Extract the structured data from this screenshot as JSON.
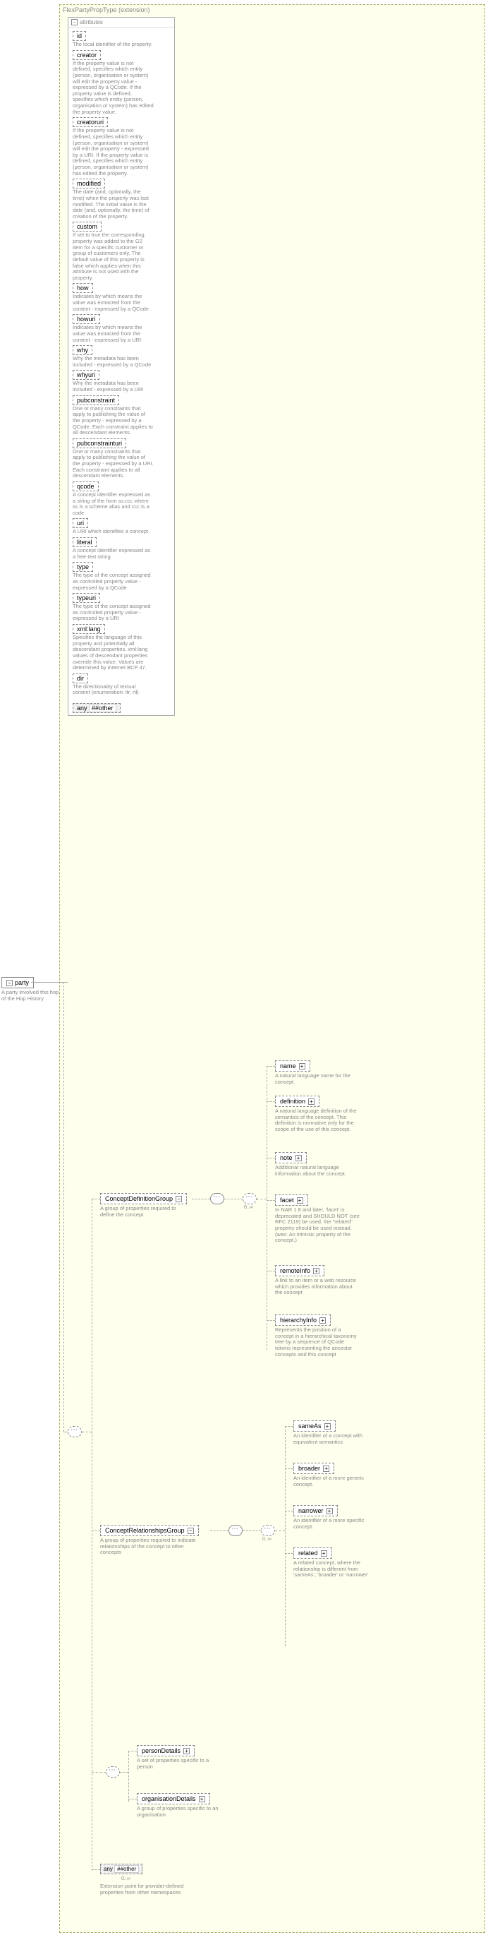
{
  "extension": {
    "title": "FlexPartyPropType (extension)"
  },
  "root": {
    "label": "party",
    "annotation": "A party involved this hop of the Hop History"
  },
  "attributes_title": "attributes",
  "attributes": [
    {
      "label": "id",
      "annotation": "The local identifier of the property."
    },
    {
      "label": "creator",
      "annotation": "If the property value is not defined, specifies which entity (person, organisation or system) will edit the property value - expressed by a QCode. If the property value is defined, specifies which entity (person, organisation or system) has edited the property value."
    },
    {
      "label": "creatoruri",
      "annotation": "If the property value is not defined, specifies which entity (person, organisation or system) will edit the property - expressed by a URI. If the property value is defined, specifies which entity (person, organisation or system) has edited the property."
    },
    {
      "label": "modified",
      "annotation": "The date (and, optionally, the time) when the property was last modified. The initial value is the date (and, optionally, the time) of creation of the property."
    },
    {
      "label": "custom",
      "annotation": "If set to true the corresponding property was added to the G2 Item for a specific customer or group of customers only. The default value of this property is false which applies when this attribute is not used with the property."
    },
    {
      "label": "how",
      "annotation": "Indicates by which means the value was extracted from the content - expressed by a QCode"
    },
    {
      "label": "howuri",
      "annotation": "Indicates by which means the value was extracted from the content - expressed by a URI"
    },
    {
      "label": "why",
      "annotation": "Why the metadata has been included - expressed by a QCode"
    },
    {
      "label": "whyuri",
      "annotation": "Why the metadata has been included - expressed by a URI"
    },
    {
      "label": "pubconstraint",
      "annotation": "One or many constraints that apply to publishing the value of the property - expressed by a QCode. Each constraint applies to all descendant elements."
    },
    {
      "label": "pubconstrainturi",
      "annotation": "One or many constraints that apply to publishing the value of the property - expressed by a URI. Each constraint applies to all descendant elements."
    },
    {
      "label": "qcode",
      "annotation": "A concept identifier expressed as a string of the form ss:ccc where ss is a scheme alias and ccc is a code"
    },
    {
      "label": "uri",
      "annotation": "A URI which identifies a concept."
    },
    {
      "label": "literal",
      "annotation": "A concept identifier expressed as a free text string"
    },
    {
      "label": "type",
      "annotation": "The type of the concept assigned as controlled property value - expressed by a QCode"
    },
    {
      "label": "typeuri",
      "annotation": "The type of the concept assigned as controlled property value - expressed by a URI"
    },
    {
      "label": "xml:lang",
      "annotation": "Specifies the language of this property and potentially all descendant properties. xml:lang values of descendant properties override this value. Values are determined by Internet BCP 47."
    },
    {
      "label": "dir",
      "annotation": "The directionality of textual content (enumeration: ltr, rtl)"
    }
  ],
  "any_attr": {
    "prefix": "any",
    "wildcard": "##other"
  },
  "groups": {
    "defGroup": {
      "label": "ConceptDefinitionGroup",
      "annotation": "A group of properties required to define the concept"
    },
    "relGroup": {
      "label": "ConceptRelationshipsGroup",
      "annotation": "A group of properties required to indicate relationships of the concept to other concepts"
    }
  },
  "defChildren": [
    {
      "label": "name",
      "annotation": "A natural language name for the concept."
    },
    {
      "label": "definition",
      "annotation": "A natural language definition of the semantics of the concept. This definition is normative only for the scope of the use of this concept."
    },
    {
      "label": "note",
      "annotation": "Additional natural language information about the concept."
    },
    {
      "label": "facet",
      "annotation": "In NAR 1.8 and later, 'facet' is deprecated and SHOULD NOT (see RFC 2119) be used, the \"related\" property should be used instead. (was: An intrinsic property of the concept.)"
    },
    {
      "label": "remoteInfo",
      "annotation": "A link to an item or a web resource which provides information about the concept"
    },
    {
      "label": "hierarchyInfo",
      "annotation": "Represents the position of a concept in a hierarchical taxonomy tree by a sequence of QCode tokens representing the ancestor concepts and this concept"
    }
  ],
  "relChildren": [
    {
      "label": "sameAs",
      "annotation": "An identifier of a concept with equivalent semantics"
    },
    {
      "label": "broader",
      "annotation": "An identifier of a more generic concept."
    },
    {
      "label": "narrower",
      "annotation": "An identifier of a more specific concept."
    },
    {
      "label": "related",
      "annotation": "A related concept, where the relationship is different from 'sameAs', 'broader' or 'narrower'."
    }
  ],
  "choice": {
    "personDetails": {
      "label": "personDetails",
      "annotation": "A set of properties specific to a person"
    },
    "orgDetails": {
      "label": "organisationDetails",
      "annotation": "A group of properties specific to an organisation"
    }
  },
  "any_elem": {
    "prefix": "any",
    "wildcard": "##other",
    "annotation": "Extension point for provider-defined properties from other namespaces"
  },
  "card0inf": "0..∞",
  "card0inf2": "0..∞",
  "card0inf3": "0..∞"
}
